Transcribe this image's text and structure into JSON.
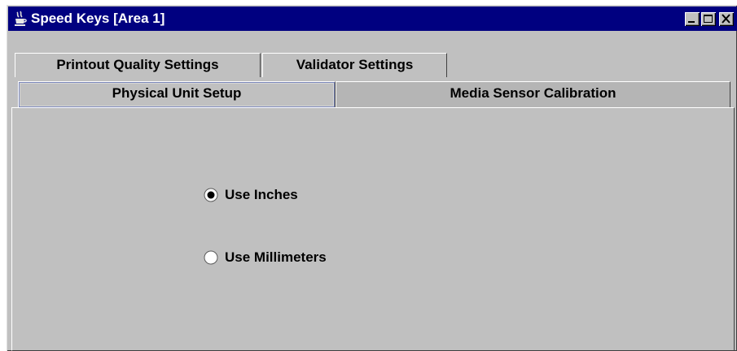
{
  "window": {
    "title": "Speed Keys [Area 1]",
    "app_icon": "java-cup-icon",
    "controls": [
      "minimize-icon",
      "maximize-icon",
      "close-icon"
    ]
  },
  "tabs": {
    "back_row": [
      {
        "label": "Printout Quality Settings"
      },
      {
        "label": "Validator Settings"
      }
    ],
    "front_row": [
      {
        "label": "Physical Unit Setup",
        "selected": true
      },
      {
        "label": "Media Sensor Calibration",
        "selected": false
      }
    ]
  },
  "panel": {
    "unit_options": [
      {
        "label": "Use Inches",
        "checked": true
      },
      {
        "label": "Use Millimeters",
        "checked": false
      }
    ]
  },
  "colors": {
    "title_bar": "#000080",
    "face": "#c0c0c0",
    "title_text": "#ffffff"
  }
}
